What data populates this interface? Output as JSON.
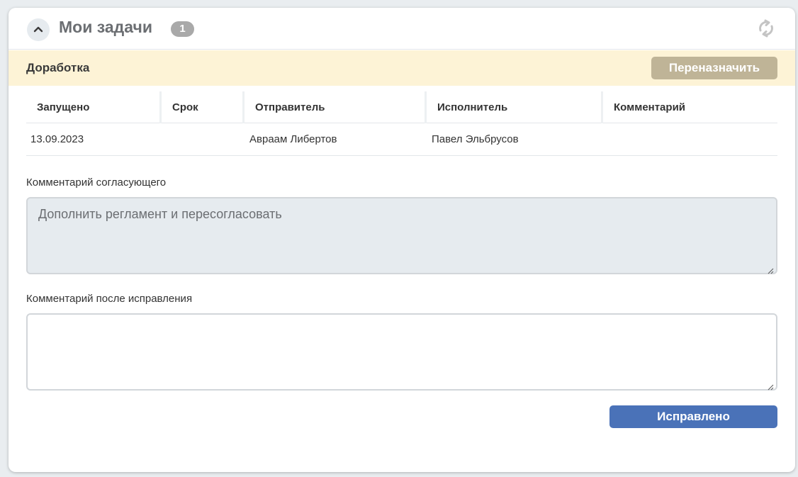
{
  "header": {
    "title": "Мои задачи",
    "count": "1",
    "collapse_icon": "chevron-up-icon",
    "refresh_icon": "refresh-icon"
  },
  "banner": {
    "title": "Доработка",
    "reassign_label": "Переназначить"
  },
  "table": {
    "columns": [
      "Запущено",
      "Срок",
      "Отправитель",
      "Исполнитель",
      "Комментарий"
    ],
    "rows": [
      [
        "13.09.2023",
        "",
        "Авраам Либертов",
        "Павел Эльбрусов",
        ""
      ]
    ]
  },
  "approver_comment": {
    "label": "Комментарий согласующего",
    "value": "Дополнить регламент и пересогласовать"
  },
  "fix_comment": {
    "label": "Комментарий после исправления",
    "value": "",
    "placeholder": ""
  },
  "actions": {
    "fixed_label": "Исправлено"
  },
  "colors": {
    "banner_bg": "#fdf3d6",
    "reassign_bg": "#bfb497",
    "primary": "#4a72b8",
    "badge_bg": "#a9a9a9"
  }
}
